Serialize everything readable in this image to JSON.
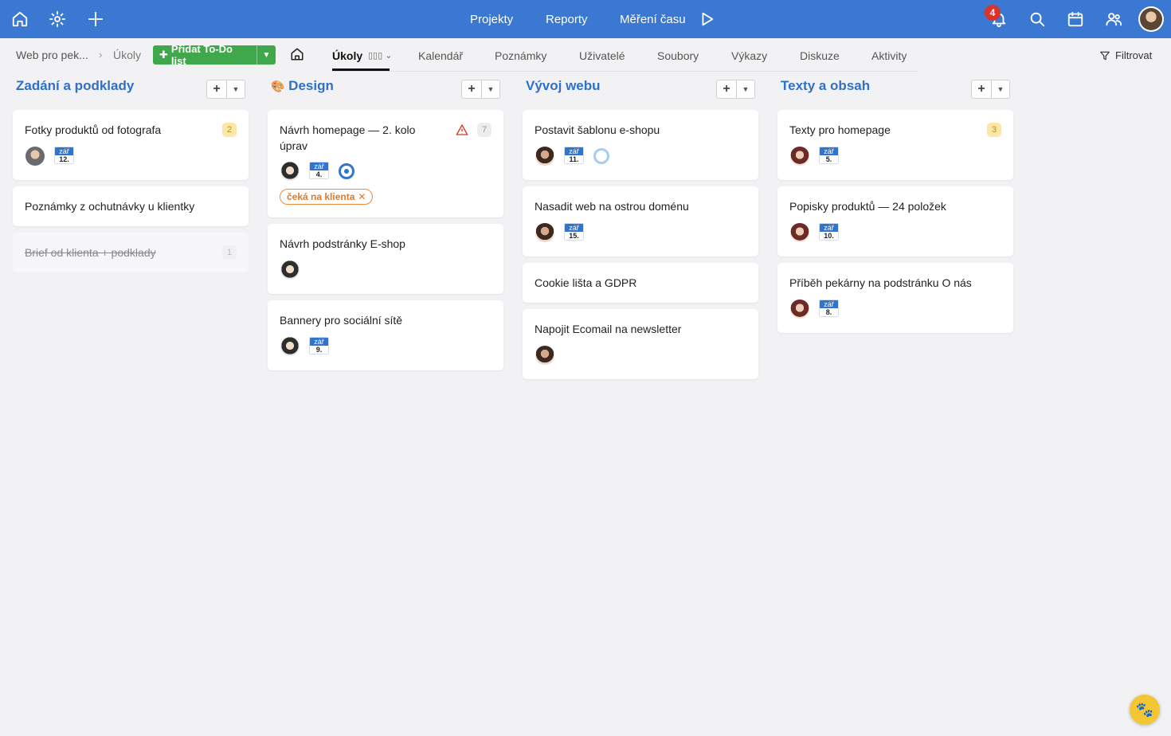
{
  "topbar": {
    "nav": [
      {
        "label": "Projekty"
      },
      {
        "label": "Reporty"
      },
      {
        "label": "Měření času"
      }
    ],
    "notification_count": "4",
    "icons": [
      "home-icon",
      "gear-icon",
      "plus-icon",
      "play-icon",
      "bell-icon",
      "search-icon",
      "calendar-icon",
      "users-icon"
    ]
  },
  "breadcrumb": {
    "project": "Web pro pek...",
    "current": "Úkoly"
  },
  "add_button": {
    "label": "Přidat To-Do list"
  },
  "tabs": [
    {
      "label": "Úkoly"
    },
    {
      "label": "Kalendář"
    },
    {
      "label": "Poznámky"
    },
    {
      "label": "Uživatelé"
    },
    {
      "label": "Soubory"
    },
    {
      "label": "Výkazy"
    },
    {
      "label": "Diskuze"
    },
    {
      "label": "Aktivity"
    }
  ],
  "filter_label": "Filtrovat",
  "columns": [
    {
      "title": "Zadání a podklady",
      "cards": [
        {
          "title": "Fotky produktů od fotografa",
          "count": "2",
          "date_month": "zář",
          "date_day": "12."
        },
        {
          "title": "Poznámky z ochutnávky u klientky"
        },
        {
          "title": "Brief od klienta + podklady",
          "count": "1"
        }
      ]
    },
    {
      "title": "Design",
      "cards": [
        {
          "title": "Návrh homepage — 2. kolo úprav",
          "count": "7",
          "date_month": "zář",
          "date_day": "4.",
          "tag": "čeká na klienta"
        },
        {
          "title": "Návrh podstránky E-shop"
        },
        {
          "title": "Bannery pro sociální sítě",
          "date_month": "zář",
          "date_day": "9."
        }
      ]
    },
    {
      "title": "Vývoj webu",
      "cards": [
        {
          "title": "Postavit šablonu e-shopu",
          "date_month": "zář",
          "date_day": "11."
        },
        {
          "title": "Nasadit web na ostrou doménu",
          "date_month": "zář",
          "date_day": "15."
        },
        {
          "title": "Cookie lišta a GDPR"
        },
        {
          "title": "Napojit Ecomail na newsletter"
        }
      ]
    },
    {
      "title": "Texty a obsah",
      "cards": [
        {
          "title": "Texty pro homepage",
          "count": "3",
          "date_month": "zář",
          "date_day": "5."
        },
        {
          "title": "Popisky produktů — 24 položek",
          "date_month": "zář",
          "date_day": "10."
        },
        {
          "title": "Příběh pekárny na podstránku O nás",
          "date_month": "zář",
          "date_day": "8."
        }
      ]
    }
  ]
}
